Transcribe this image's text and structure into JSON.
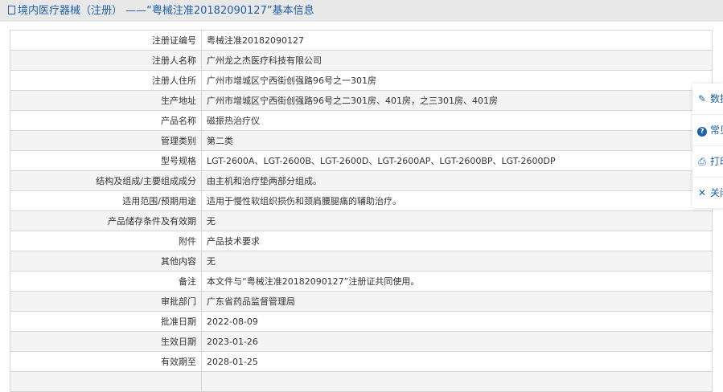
{
  "header": {
    "title": "境内医疗器械（注册） ——“粤械注准20182090127”基本信息"
  },
  "rows": [
    {
      "label": "注册证编号",
      "value": "粤械注准20182090127"
    },
    {
      "label": "注册人名称",
      "value": "广州龙之杰医疗科技有限公司"
    },
    {
      "label": "注册人住所",
      "value": "广州市增城区宁西街创强路96号之一301房"
    },
    {
      "label": "生产地址",
      "value": "广州市增城区宁西街创强路96号之二301房、401房，之三301房、401房"
    },
    {
      "label": "产品名称",
      "value": "磁振热治疗仪"
    },
    {
      "label": "管理类别",
      "value": "第二类"
    },
    {
      "label": "型号规格",
      "value": "LGT-2600A、LGT-2600B、LGT-2600D、LGT-2600AP、LGT-2600BP、LGT-2600DP"
    },
    {
      "label": "结构及组成/主要组成成分",
      "value": "由主机和治疗垫两部分组成。"
    },
    {
      "label": "适用范围/预期用途",
      "value": "适用于慢性软组织损伤和颈肩腰腿痛的辅助治疗。"
    },
    {
      "label": "产品储存条件及有效期",
      "value": "无"
    },
    {
      "label": "附件",
      "value": "产品技术要求"
    },
    {
      "label": "其他内容",
      "value": "无"
    },
    {
      "label": "备注",
      "value": "本文件与“粤械注准20182090127”注册证共同使用。"
    },
    {
      "label": "审批部门",
      "value": "广东省药品监督管理局"
    },
    {
      "label": "批准日期",
      "value": "2022-08-09"
    },
    {
      "label": "生效日期",
      "value": "2023-01-26"
    },
    {
      "label": "有效期至",
      "value": "2028-01-25"
    }
  ],
  "menu": [
    {
      "icon": "edit-icon",
      "label": "数据"
    },
    {
      "icon": "help-icon",
      "label": "常见"
    },
    {
      "icon": "print-icon",
      "label": "打印"
    },
    {
      "icon": "close-icon",
      "label": "关闭"
    }
  ]
}
